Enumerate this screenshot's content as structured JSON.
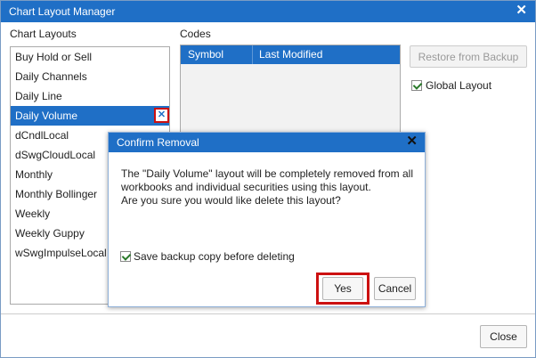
{
  "window": {
    "title": "Chart Layout Manager"
  },
  "layouts": {
    "heading": "Chart Layouts",
    "items": [
      "Buy Hold or Sell",
      "Daily Channels",
      "Daily Line",
      "Daily Volume",
      "dCndlLocal",
      "dSwgCloudLocal",
      "Monthly",
      "Monthly Bollinger",
      "Weekly",
      "Weekly Guppy",
      "wSwgImpulseLocal"
    ],
    "selected": "Daily Volume",
    "delete_glyph": "✕"
  },
  "codes": {
    "heading": "Codes",
    "columns": [
      "Symbol",
      "Last Modified"
    ]
  },
  "actions": {
    "restore_label": "Restore from Backup",
    "global_layout_label": "Global Layout",
    "global_layout_checked": true,
    "close_label": "Close"
  },
  "dialog": {
    "title": "Confirm Removal",
    "message_line1": "The \"Daily Volume\" layout will be completely removed from all",
    "message_line2": "workbooks and individual securities using this layout.",
    "message_line3": "Are you sure you would like delete this layout?",
    "backup_label": "Save backup copy before deleting",
    "backup_checked": true,
    "yes_label": "Yes",
    "cancel_label": "Cancel"
  },
  "icons": {
    "close": "close-icon",
    "delete": "delete-icon",
    "check": "checkmark-icon"
  },
  "colors": {
    "accent": "#1f6fc6",
    "highlight": "#cc1111"
  }
}
